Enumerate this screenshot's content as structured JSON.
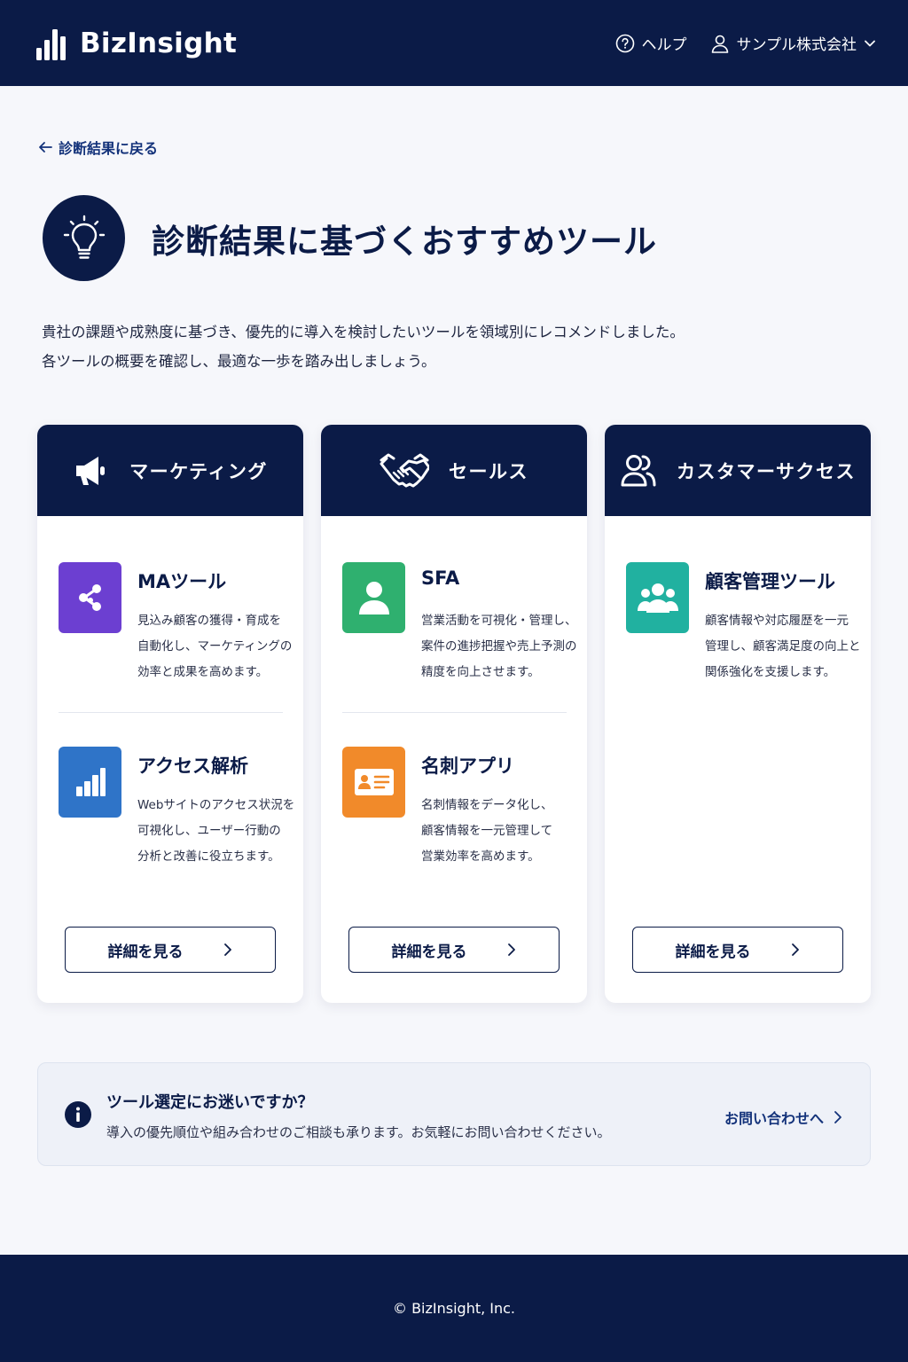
{
  "header": {
    "brand": "BizInsight",
    "help_label": "ヘルプ",
    "account_label": "サンプル株式会社"
  },
  "back_link": "診断結果に戻る",
  "page_title": "診断結果に基づくおすすめツール",
  "intro": {
    "line1": "貴社の課題や成熟度に基づき、優先的に導入を検討したいツールを領域別にレコメンドしました。",
    "line2": "各ツールの概要を確認し、最適な一歩を踏み出しましょう。"
  },
  "columns": [
    {
      "title": "マーケティング",
      "icon": "megaphone-icon",
      "tools": [
        {
          "name": "MAツール",
          "desc": "見込み顧客の獲得・育成を\n自動化し、マーケティングの\n効率と成果を高めます。",
          "icon": "network-icon",
          "color": "#6c3fd1"
        },
        {
          "name": "アクセス解析",
          "desc": "Webサイトのアクセス状況を\n可視化し、ユーザー行動の\n分析と改善に役立ちます。",
          "icon": "bar-chart-icon",
          "color": "#2f74c8"
        }
      ],
      "button": "詳細を見る"
    },
    {
      "title": "セールス",
      "icon": "handshake-icon",
      "tools": [
        {
          "name": "SFA",
          "desc": "営業活動を可視化・管理し、\n案件の進捗把握や売上予測の\n精度を向上させます。",
          "icon": "person-icon",
          "color": "#2fb06f"
        },
        {
          "name": "名刺アプリ",
          "desc": "名刺情報をデータ化し、\n顧客情報を一元管理して\n営業効率を高めます。",
          "icon": "business-card-icon",
          "color": "#f18a2a"
        }
      ],
      "button": "詳細を見る"
    },
    {
      "title": "カスタマーサクセス",
      "icon": "users-icon",
      "tools": [
        {
          "name": "顧客管理ツール",
          "desc": "顧客情報や対応履歴を一元\n管理し、顧客満足度の向上と\n関係強化を支援します。",
          "icon": "group-icon",
          "color": "#21b1a0"
        }
      ],
      "button": "詳細を見る"
    }
  ],
  "help_box": {
    "title": "ツール選定にお迷いですか？",
    "text": "導入の優先順位や組み合わせのご相談も承ります。お気軽にお問い合わせください。",
    "link": "お問い合わせへ"
  },
  "footer": "© BizInsight, Inc."
}
